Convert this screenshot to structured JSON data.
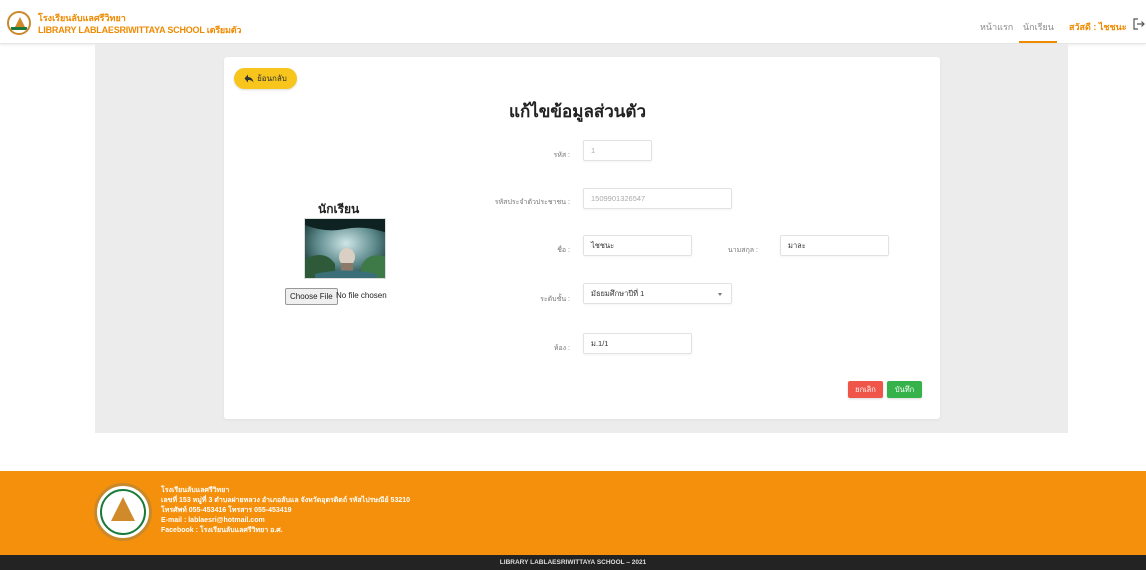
{
  "header": {
    "school_name": "โรงเรียนลับแลศรีวิทยา",
    "system_name": "LIBRARY LABLAESRIWITTAYA SCHOOL เตรียมตัว",
    "nav": {
      "home": "หน้าแรก",
      "students": "นักเรียน",
      "user": "สวัสดี : ไชชนะ"
    }
  },
  "back_button": {
    "label": "ย้อนกลับ"
  },
  "page_title": "แก้ไขข้อมูลส่วนตัว",
  "photo": {
    "title": "นักเรียน",
    "choose_file_label": "Choose File",
    "file_status": "No file chosen"
  },
  "form": {
    "code": {
      "label": "รหัส :",
      "value": "1"
    },
    "national_id": {
      "label": "รหัสประจำตัวประชาชน :",
      "value": "1509901326547"
    },
    "first_name": {
      "label": "ชื่อ :",
      "value": "ไชชนะ"
    },
    "last_name": {
      "label": "นามสกุล :",
      "value": "มาละ"
    },
    "level": {
      "label": "ระดับชั้น :",
      "value": "มัธยมศึกษาปีที่ 1"
    },
    "room": {
      "label": "ห้อง :",
      "value": "ม.1/1"
    }
  },
  "buttons": {
    "cancel": "ยกเลิก",
    "save": "บันทึก"
  },
  "footer": {
    "lines": [
      "โรงเรียนลับแลศรีวิทยา",
      "เลขที่ 153 หมู่ที่ 3 ตำบลฝายหลวง อำเภอลับแล จังหวัดอุตรดิตถ์ รหัสไปรษณีย์ 53210",
      "โทรศัพท์ 055-453416 โทรสาร 055-453419",
      "E-mail : lablaesri@hotmail.com",
      "Facebook : โรงเรียนลับแลศรีวิทยา อ.ศ."
    ],
    "copyright": "LIBRARY LABLAESRIWITTAYA SCHOOL ‒ 2021"
  },
  "colors": {
    "accent": "#ef8a00",
    "footer_bg": "#f4900b",
    "back_button": "#f7c51c",
    "cancel": "#f0554a",
    "save": "#36b24a"
  },
  "icons": {
    "back": "back-arrow-icon",
    "logout": "logout-icon",
    "select": "chevron-down-icon"
  }
}
